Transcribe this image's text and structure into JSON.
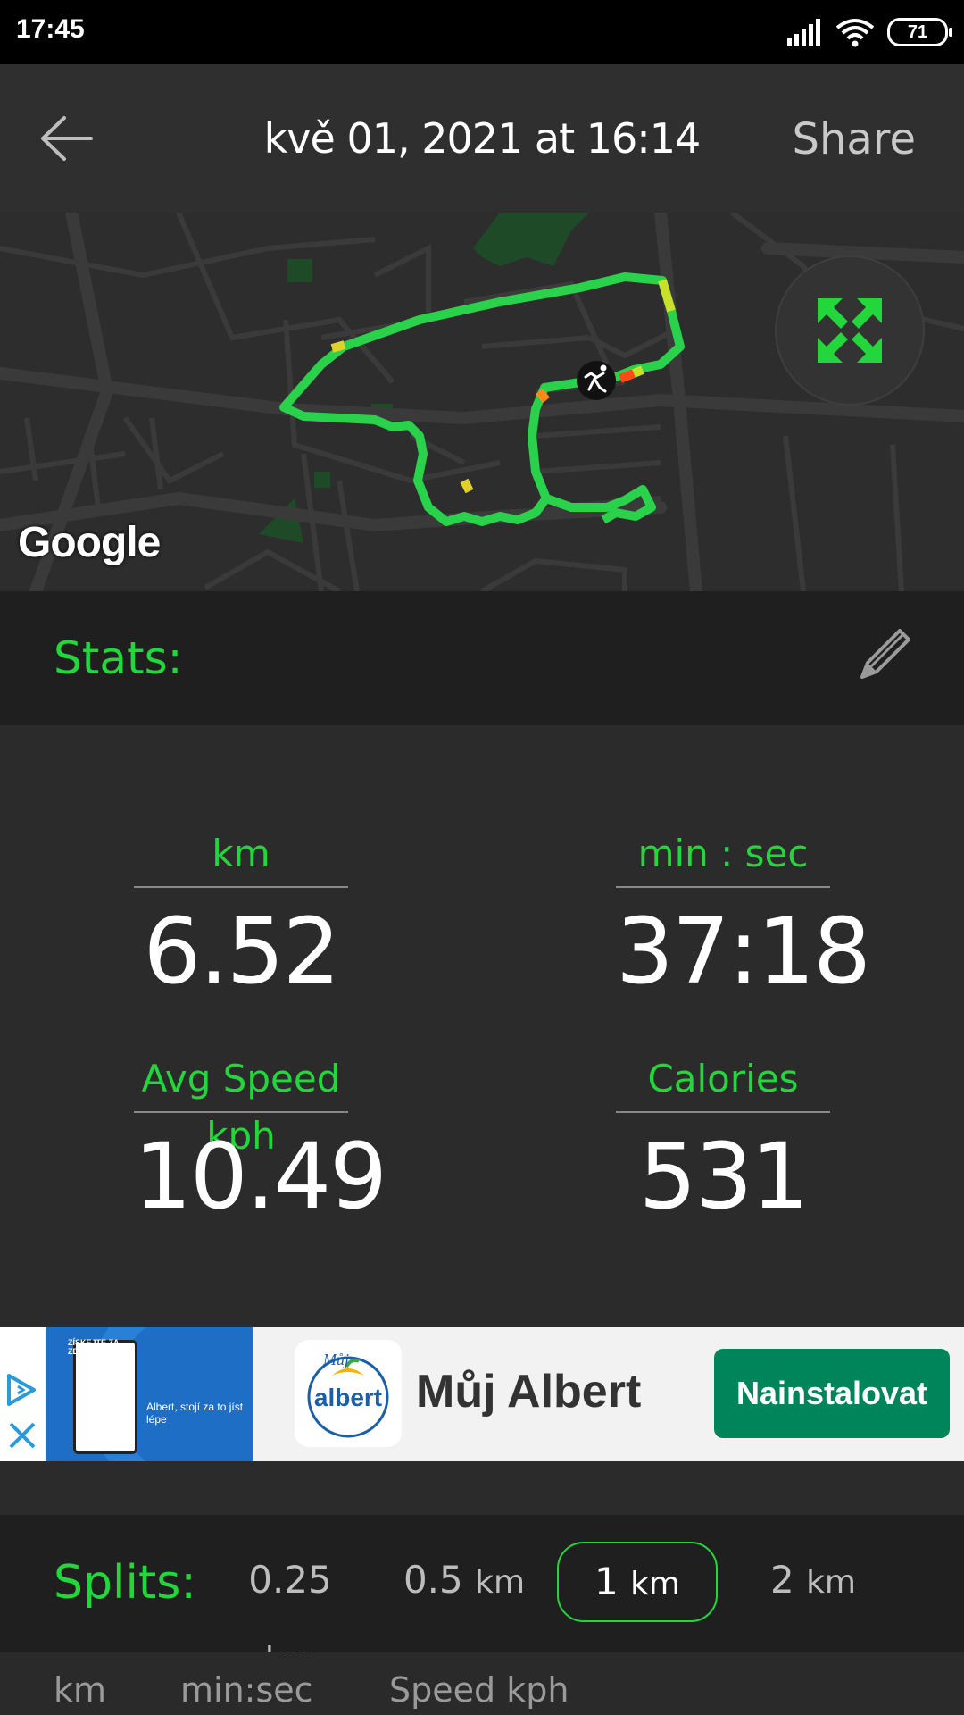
{
  "status_bar": {
    "time": "17:45",
    "battery": "71"
  },
  "header": {
    "title": "kvě 01, 2021 at 16:14",
    "share_label": "Share"
  },
  "map": {
    "attribution": "Google"
  },
  "stats": {
    "title": "Stats:",
    "items": [
      {
        "label": "km",
        "value": "6.52"
      },
      {
        "label": "min : sec",
        "value": "37:18"
      },
      {
        "label": "Avg Speed kph",
        "value": "10.49"
      },
      {
        "label": "Calories",
        "value": "531"
      }
    ]
  },
  "ad": {
    "app_name": "Můj Albert",
    "install_label": "Nainstalovat",
    "logo_text": "albert",
    "logo_script": "Můj",
    "image_text": "Albert, stojí za to jíst lépe",
    "image_badge": "ZÍSKEJTE ZA ZDRAVÉ JÍDLO"
  },
  "splits": {
    "title": "Splits:",
    "options": [
      {
        "value": "0.25",
        "unit": "km"
      },
      {
        "value": "0.5",
        "unit": "km"
      },
      {
        "value": "1",
        "unit": "km"
      },
      {
        "value": "2",
        "unit": "km"
      }
    ],
    "selected": "1 km"
  },
  "table": {
    "columns": [
      "km",
      "min:sec",
      "Speed kph"
    ]
  },
  "colors": {
    "accent": "#22d63c",
    "background": "#2b2b2b",
    "ad_button": "#00845a"
  }
}
